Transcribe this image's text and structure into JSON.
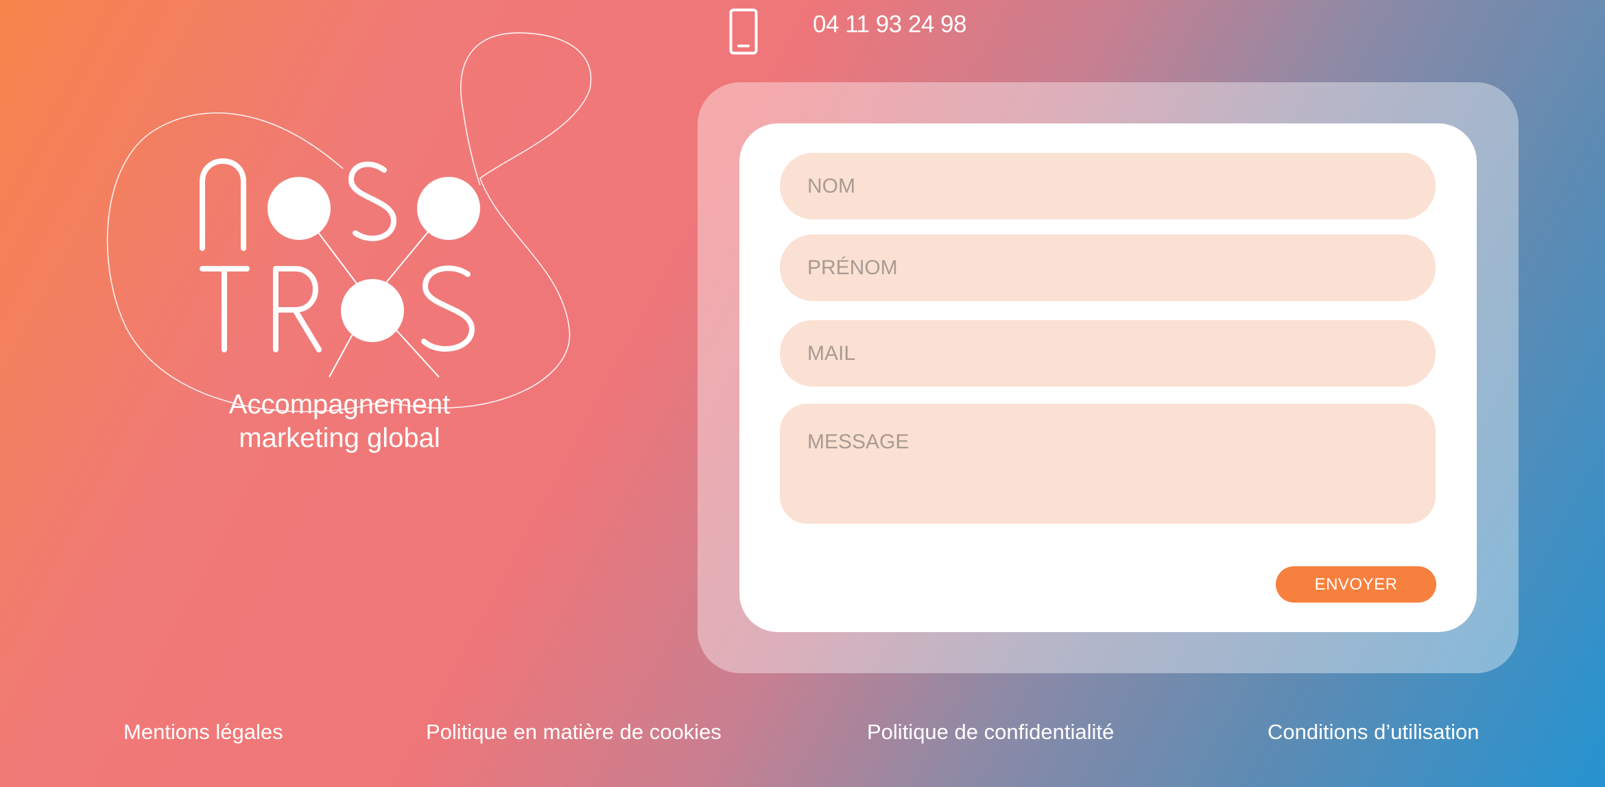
{
  "header": {
    "phone_icon": "mobile-phone-icon",
    "phone_number": "04 11 93 24 98"
  },
  "brand": {
    "logo_text": "NOSOTROS",
    "tagline_line1": "Accompagnement",
    "tagline_line2": "marketing global"
  },
  "contact_form": {
    "nom_placeholder": "NOM",
    "prenom_placeholder": "PRÉNOM",
    "mail_placeholder": "MAIL",
    "message_placeholder": "MESSAGE",
    "submit_label": "ENVOYER"
  },
  "footer": {
    "links": [
      "Mentions légales",
      "Politique en matière de cookies",
      "Politique de confidentialité",
      "Conditions d’utilisation"
    ]
  },
  "colors": {
    "accent": "#f7803e",
    "field_bg": "#fbe1d3",
    "card_bg": "#ffffff",
    "gradient_start": "#f6844a",
    "gradient_end": "#2593d0"
  }
}
